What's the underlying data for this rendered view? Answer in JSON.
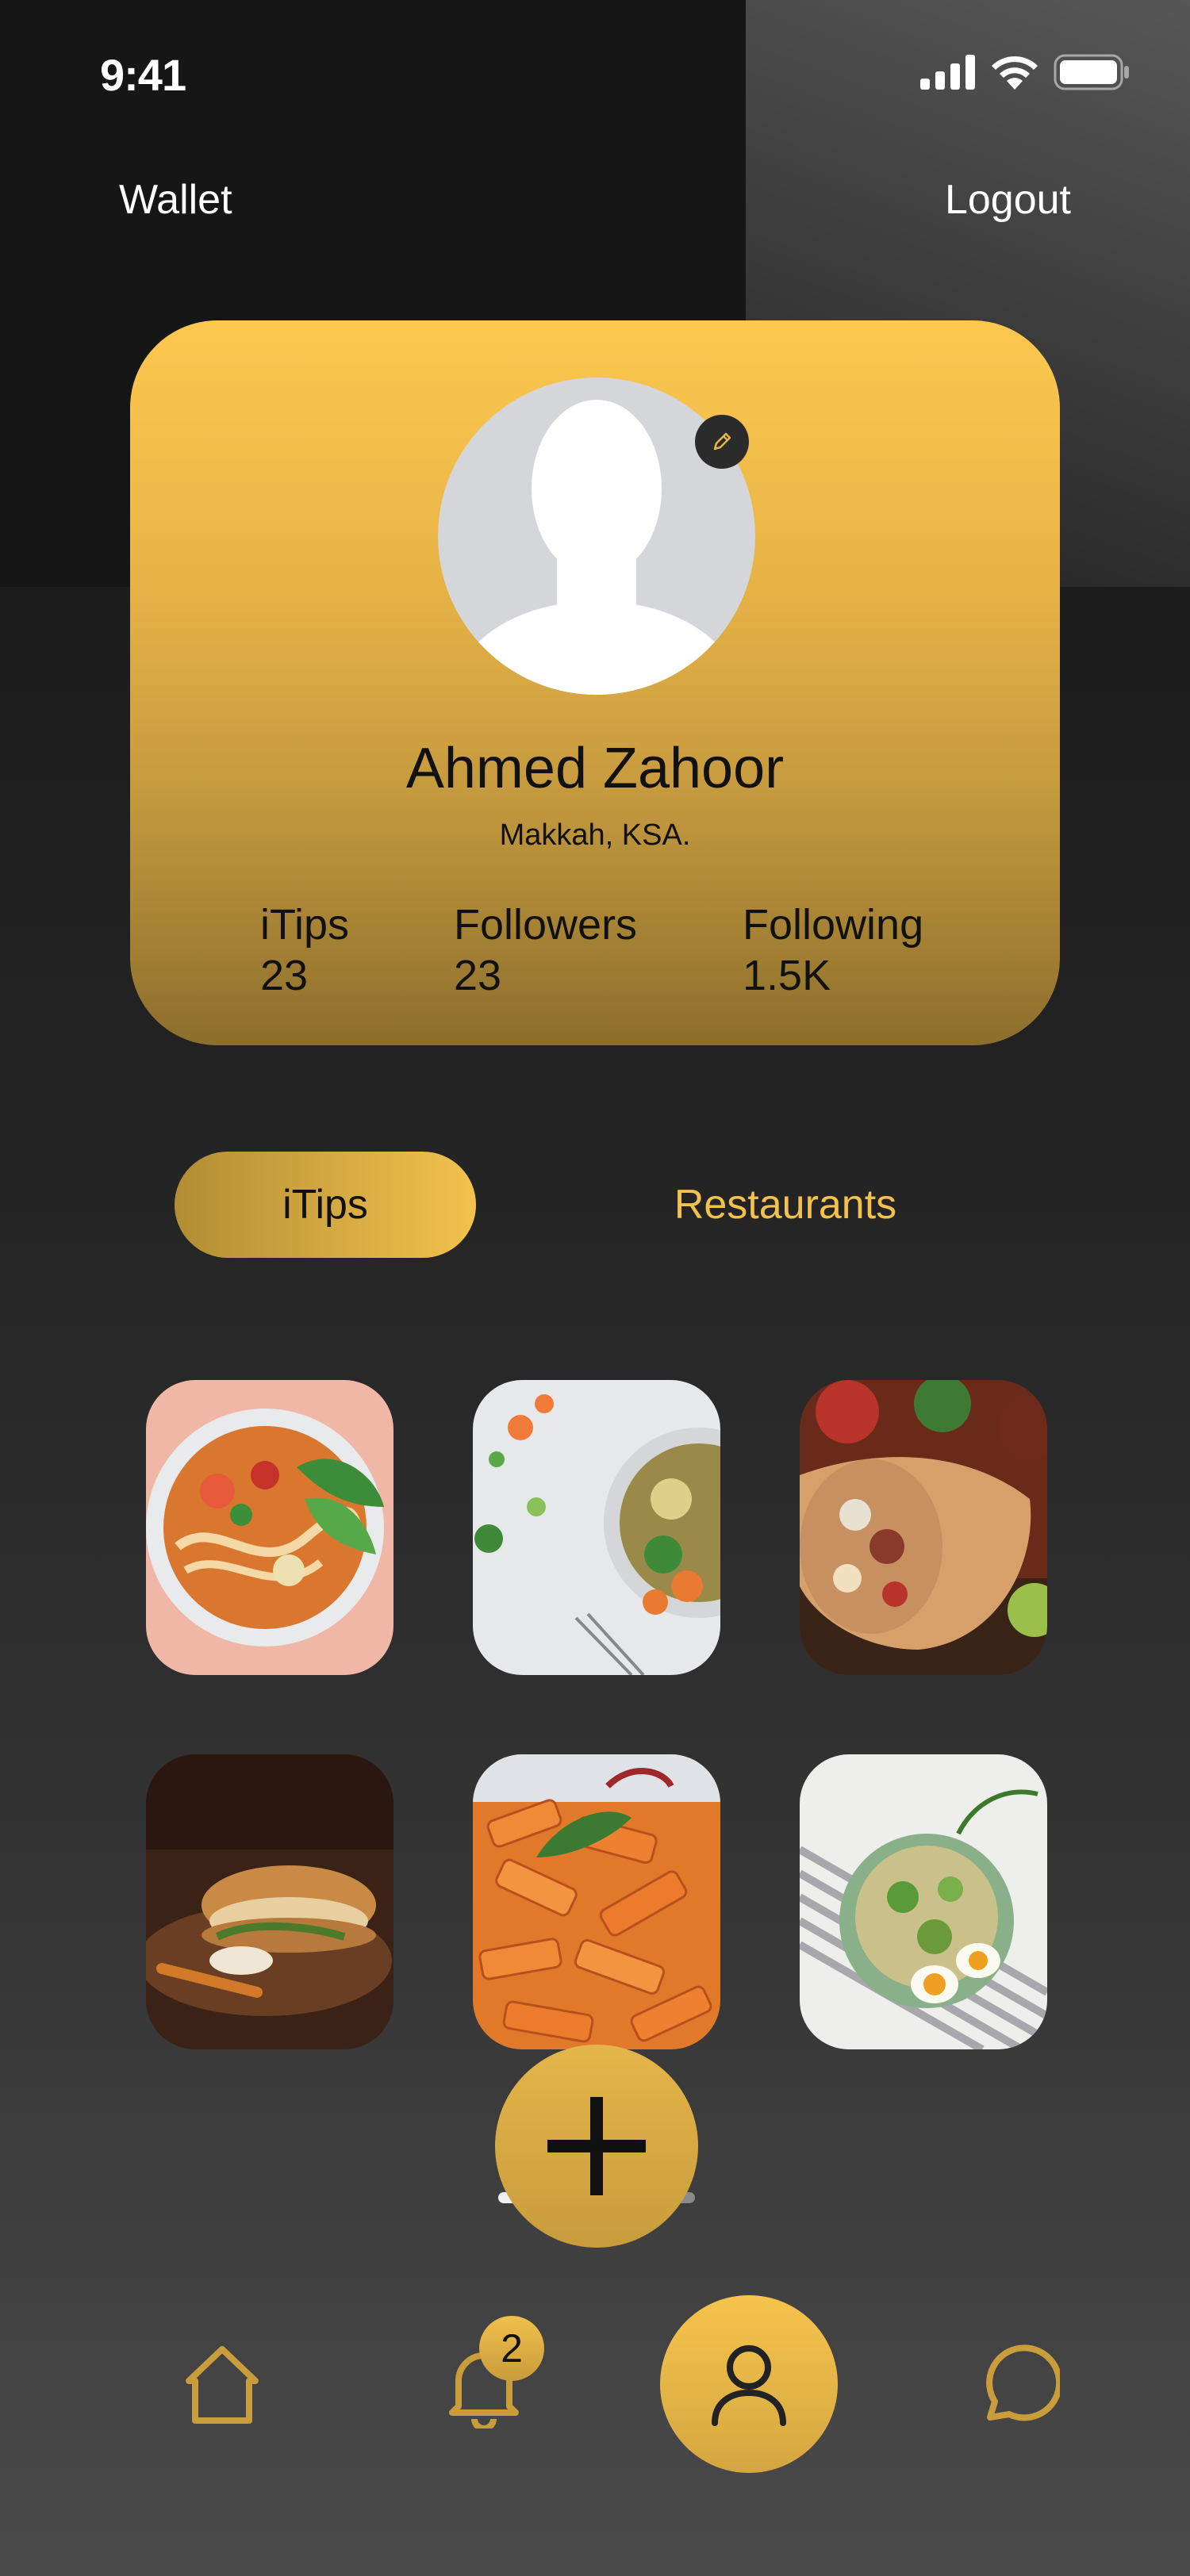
{
  "status_bar": {
    "time": "9:41"
  },
  "header": {
    "wallet_label": "Wallet",
    "logout_label": "Logout"
  },
  "profile": {
    "name": "Ahmed Zahoor",
    "location": "Makkah, KSA.",
    "stats": [
      {
        "label": "iTips",
        "value": "23"
      },
      {
        "label": "Followers",
        "value": "23"
      },
      {
        "label": "Following",
        "value": "1.5K"
      }
    ]
  },
  "tabs": [
    {
      "label": "iTips",
      "active": true
    },
    {
      "label": "Restaurants",
      "active": false
    }
  ],
  "posts": [
    {
      "icon": "noodle-soup-photo"
    },
    {
      "icon": "vegetable-salad-bowl-photo"
    },
    {
      "icon": "burrito-wrap-photo"
    },
    {
      "icon": "sandwich-board-photo"
    },
    {
      "icon": "penne-pasta-photo"
    },
    {
      "icon": "egg-salad-bowl-photo"
    }
  ],
  "bottom_nav": {
    "items": [
      "home-icon",
      "bell-icon",
      "profile-icon",
      "chat-icon"
    ],
    "notification_count": "2",
    "active": "profile"
  },
  "colors": {
    "accent": "#F2C24D",
    "card_top": "#FDC84E",
    "card_bottom": "#8C6E2C"
  }
}
